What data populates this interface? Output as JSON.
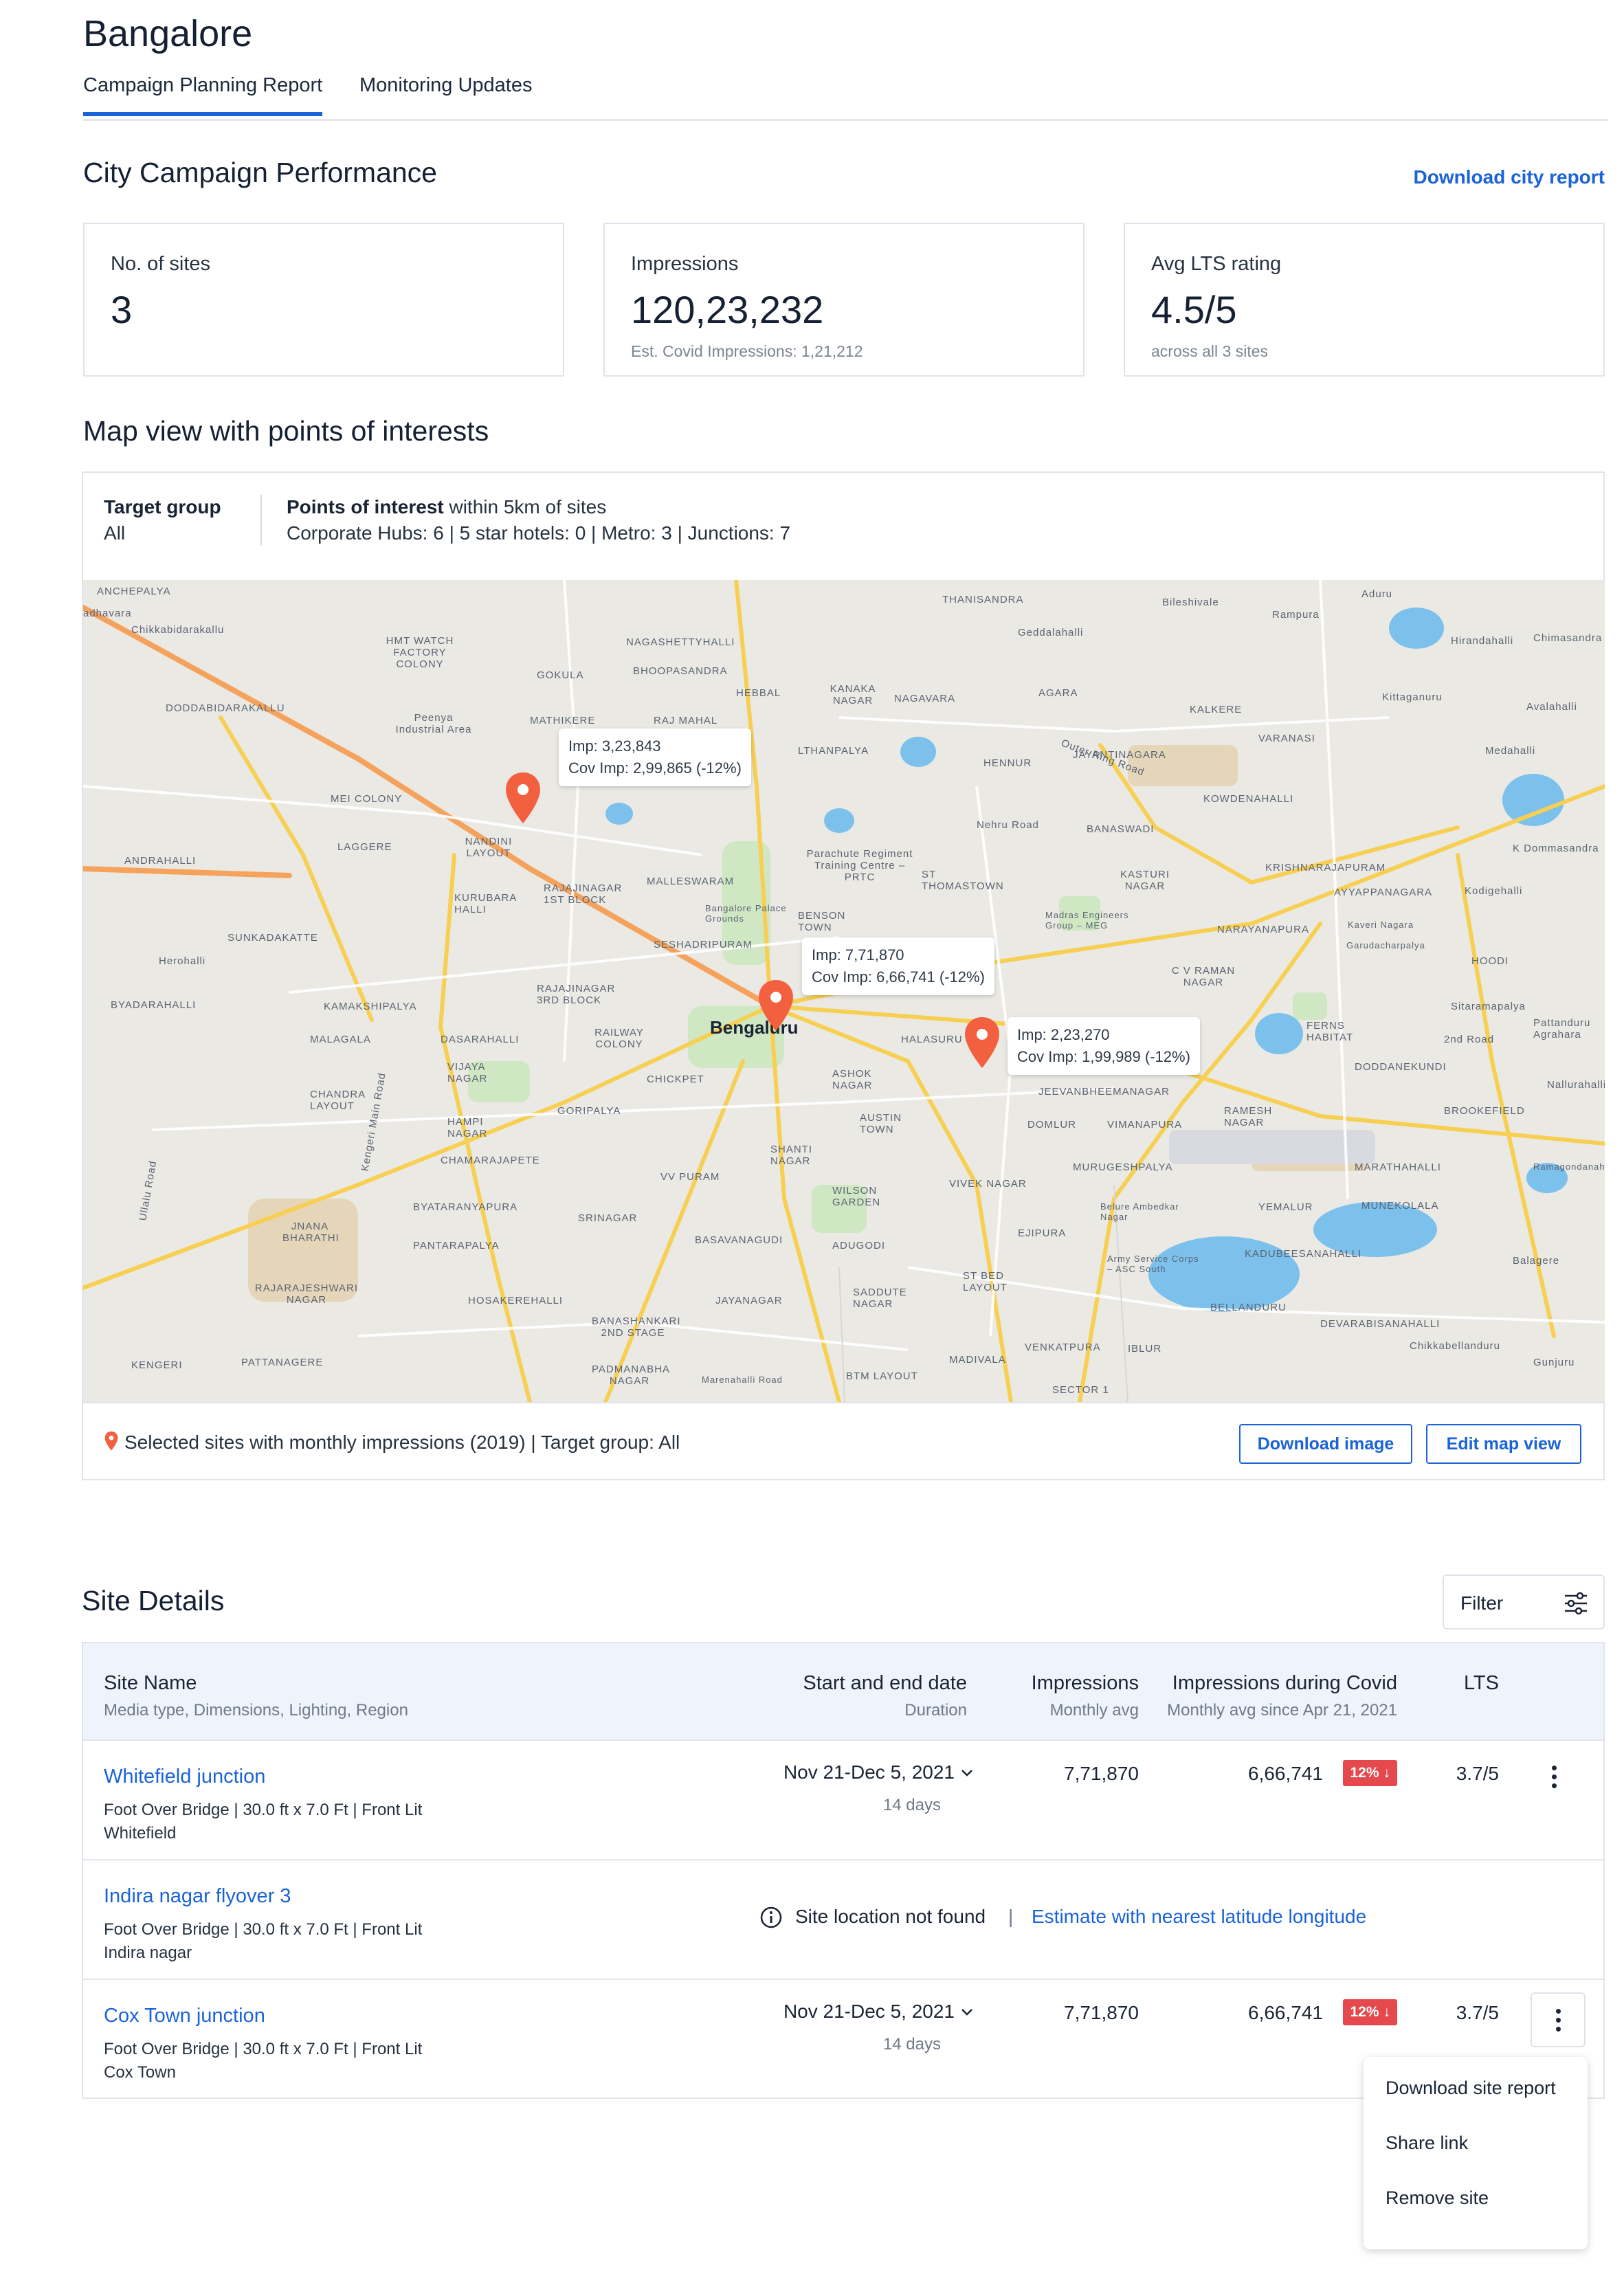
{
  "header": {
    "city": "Bangalore",
    "tabs": [
      "Campaign Planning Report",
      "Monitoring Updates"
    ],
    "active_tab": "Campaign Planning Report"
  },
  "performance": {
    "title": "City Campaign Performance",
    "download_link": "Download city report",
    "cards": [
      {
        "label": "No. of sites",
        "value": "3",
        "sub": ""
      },
      {
        "label": "Impressions",
        "value": "120,23,232",
        "sub": "Est. Covid Impressions: 1,21,212"
      },
      {
        "label": "Avg LTS rating",
        "value": "4.5/5",
        "sub": "across all 3 sites"
      }
    ]
  },
  "map_section": {
    "title": "Map view with points of interests",
    "target_group_label": "Target group",
    "target_group_value": "All",
    "poi_title_bold": "Points of interest",
    "poi_title_rest": " within 5km of sites",
    "poi_counts": "Corporate Hubs: 6 | 5 star hotels: 0 | Metro: 3 | Junctions: 7",
    "city_label": "Bengaluru",
    "callouts": [
      {
        "imp": "Imp: 3,23,843",
        "cov": "Cov Imp: 2,99,865 (-12%)"
      },
      {
        "imp": "Imp: 7,71,870",
        "cov": "Cov Imp: 6,66,741 (-12%)"
      },
      {
        "imp": "Imp: 2,23,270",
        "cov": "Cov Imp: 1,99,989 (-12%)"
      }
    ],
    "map_labels": [
      "ANCHEPALYA",
      "Chikkabidarakallu",
      "adhavara",
      "HMT WATCH FACTORY COLONY",
      "NAGASHETTYHALLI",
      "BHOOPASANDRA",
      "HEBBAL",
      "THANISANDRA",
      "Geddalahalli",
      "Bileshivale",
      "Rampura",
      "Aduru",
      "Hirandahalli",
      "Chimasandra",
      "GOKULA",
      "KANAKA NAGAR",
      "NAGAVARA",
      "AGARA",
      "KALKERE",
      "Kittaganuru",
      "Avalahalli",
      "DODDABIDARAKALLU",
      "Peenya Industrial Area",
      "MATHIKERE",
      "RAJ MAHAL",
      "LTHANPALYA",
      "HENNUR",
      "JAYANTINAGARA",
      "VARANASI",
      "Medahalli",
      "MEI COLONY",
      "KOWDENAHALLI",
      "BANASWADI",
      "Parachute Regiment Training Centre – PRTC",
      "LAGGERE",
      "NANDINI LAYOUT",
      "MALLESWARAM",
      "ST THOMASTOWN",
      "KASTURI NAGAR",
      "KRISHNARAJAPURAM",
      "K Dommasandra",
      "ANDRAHALLI",
      "KURUBARA HALLI",
      "RAJAJINAGAR 1ST BLOCK",
      "Bangalore Palace Grounds",
      "BENSON TOWN",
      "Madras Engineers Group – MEG",
      "AYYAPPANAGARA",
      "Kodigehalli",
      "SUNKADAKATTE",
      "NARAYANAPURA",
      "Kaveri Nagara",
      "Garudacharpalya",
      "HOODI",
      "Herohalli",
      "SESHADRIPURAM",
      "C V RAMAN NAGAR",
      "BYADARAHALLI",
      "KAMAKSHIPALYA",
      "RAJAJINAGAR 3RD BLOCK",
      "Sitaramapalya",
      "Pattanduru Agrahara",
      "MALAGALA",
      "DASARAHALLI",
      "RAILWAY COLONY",
      "HALASURU",
      "FERNS HABITAT",
      "2nd Road",
      "DODDANEKUNDI",
      "VIJAYA NAGAR",
      "CHICKPET",
      "ASHOK NAGAR",
      "JEEVANBHEEMANAGAR",
      "Nallurahalli",
      "CHANDRA LAYOUT",
      "GORIPALYA",
      "HAMPI NAGAR",
      "AUSTIN TOWN",
      "DOMLUR",
      "VIMANAPURA",
      "RAMESH NAGAR",
      "BROOKEFIELD",
      "CHAMARAJAPETE",
      "SHANTI NAGAR",
      "MURUGESHPALYA",
      "MARATHAHALLI",
      "Ramagondanahalli",
      "VV PURAM",
      "WILSON GARDEN",
      "VIVEK NAGAR",
      "Belure Ambedkar Nagar",
      "YEMALUR",
      "MUNEKOLALA",
      "BYATARANYAPURA",
      "SRINAGAR",
      "EJIPURA",
      "JNANA BHARATHI",
      "PANTARAPALYA",
      "BASAVANAGUDI",
      "ADUGODI",
      "Army Service Corps – ASC South",
      "KADUBEESANAHALLI",
      "Balagere",
      "RAJARAJESHWARI NAGAR",
      "HOSAKEREHALLI",
      "JAYANAGAR",
      "SADDUTE NAGAR",
      "ST BED LAYOUT",
      "BELLANDURU",
      "BANASHANKARI 2ND STAGE",
      "DEVARABISANAHALLI",
      "Chikkabellanduru",
      "KENGERI",
      "PATTANAGERE",
      "PADMANABHA NAGAR",
      "Marenahalli Road",
      "BTM LAYOUT",
      "MADIVALA",
      "VENKATPURA",
      "IBLUR",
      "Gunjuru",
      "Ullalu Road",
      "Kengeri Main Road",
      "Outer Ring Road",
      "Nehru Road",
      "SECTOR 1"
    ],
    "footer_text": "Selected sites with monthly impressions (2019)  | Target group: All",
    "download_image": "Download image",
    "edit_map": "Edit map view",
    "pin_color": "#f2603f"
  },
  "site_details": {
    "title": "Site Details",
    "filter_label": "Filter",
    "columns": {
      "site": {
        "title": "Site Name",
        "sub": "Media type, Dimensions, Lighting, Region"
      },
      "date": {
        "title": "Start and end date",
        "sub": "Duration"
      },
      "imp": {
        "title": "Impressions",
        "sub": "Monthly avg"
      },
      "covid": {
        "title": "Impressions during Covid",
        "sub": "Monthly avg since Apr 21, 2021"
      },
      "lts": {
        "title": "LTS",
        "sub": ""
      }
    },
    "rows": [
      {
        "name": "Whitefield junction",
        "meta1": "Foot Over Bridge | 30.0 ft x 7.0 Ft | Front Lit",
        "meta2": "Whitefield",
        "date": "Nov 21-Dec 5, 2021",
        "duration": "14 days",
        "impressions": "7,71,870",
        "covid": "6,66,741",
        "badge": "12%",
        "lts": "3.7/5"
      },
      {
        "name": "Indira nagar flyover 3",
        "meta1": "Foot Over Bridge | 30.0 ft x 7.0 Ft | Front Lit",
        "meta2": "Indira nagar",
        "not_found": "Site location not found",
        "separator": "|",
        "estimate_link": "Estimate with nearest latitude longitude"
      },
      {
        "name": "Cox Town junction",
        "meta1": "Foot Over Bridge | 30.0 ft x 7.0 Ft | Front Lit",
        "meta2": "Cox Town",
        "date": "Nov 21-Dec 5, 2021",
        "duration": "14 days",
        "impressions": "7,71,870",
        "covid": "6,66,741",
        "badge": "12%",
        "lts": "3.7/5"
      }
    ],
    "row_menu": [
      "Download site report",
      "Share link",
      "Remove site"
    ]
  }
}
